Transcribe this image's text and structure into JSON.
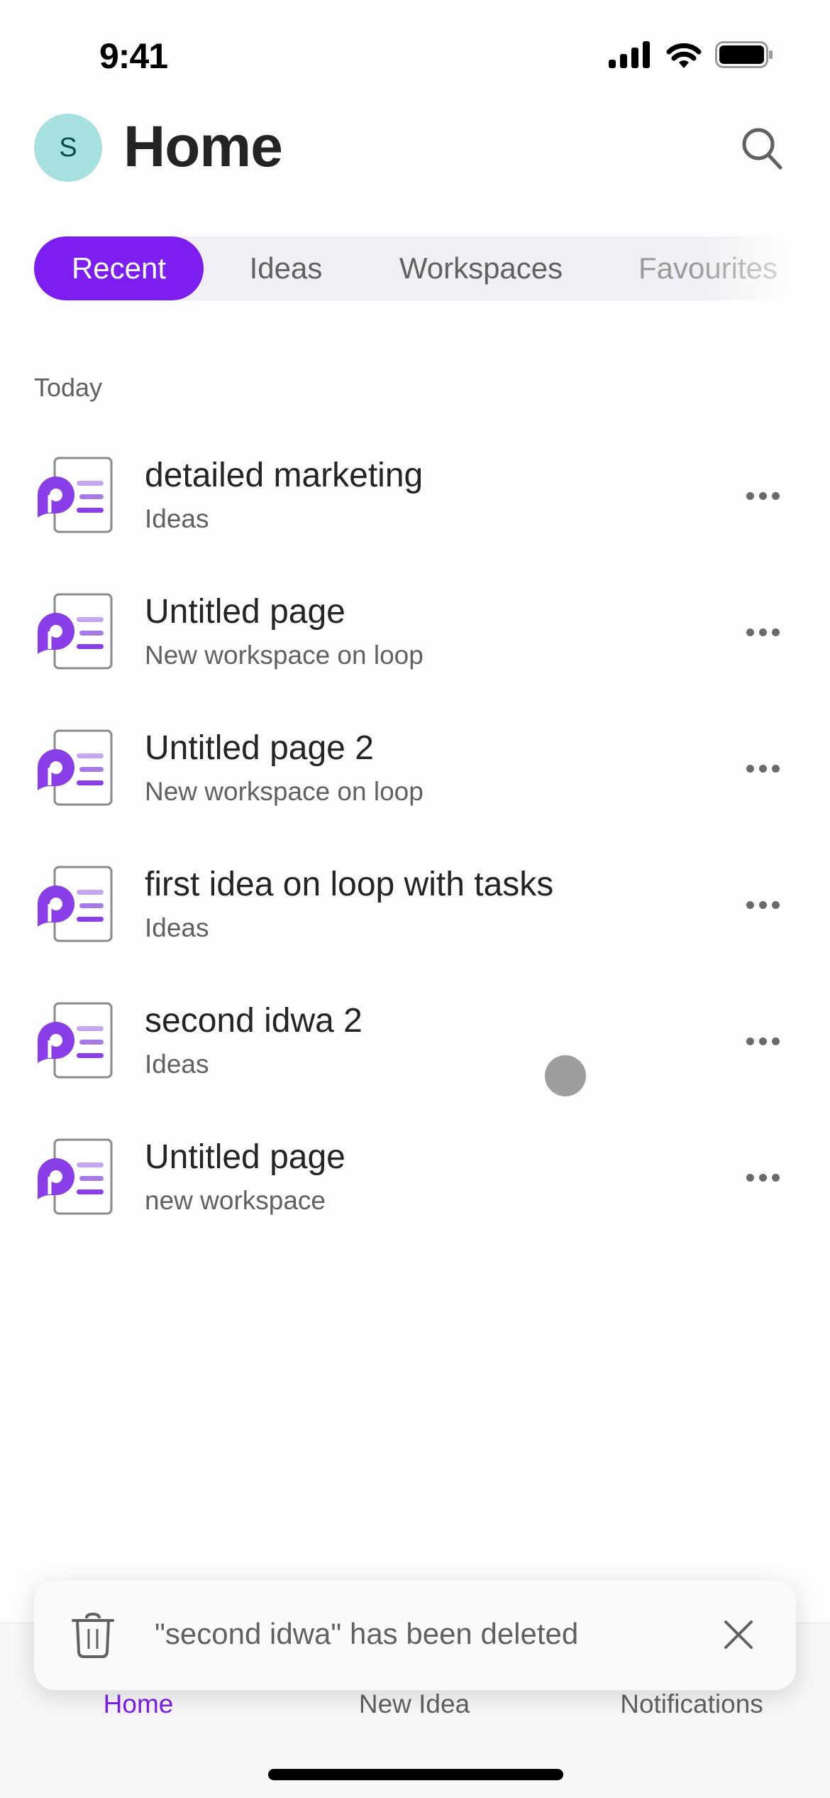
{
  "status_bar": {
    "time": "9:41"
  },
  "header": {
    "avatar_initial": "S",
    "title": "Home"
  },
  "tabs": [
    {
      "label": "Recent",
      "active": true
    },
    {
      "label": "Ideas",
      "active": false
    },
    {
      "label": "Workspaces",
      "active": false
    },
    {
      "label": "Favourites",
      "active": false
    }
  ],
  "section_label": "Today",
  "items": [
    {
      "title": "detailed marketing",
      "subtitle": "Ideas"
    },
    {
      "title": "Untitled page",
      "subtitle": "New workspace on loop"
    },
    {
      "title": "Untitled page 2",
      "subtitle": "New workspace on loop"
    },
    {
      "title": "first idea on loop with tasks",
      "subtitle": "Ideas"
    },
    {
      "title": "second idwa 2",
      "subtitle": "Ideas"
    },
    {
      "title": "Untitled page",
      "subtitle": "new workspace"
    }
  ],
  "toast": {
    "message": "\"second idwa\" has been deleted",
    "icon": "trash-icon"
  },
  "tab_bar": [
    {
      "label": "Home",
      "active": true
    },
    {
      "label": "New Idea",
      "active": false
    },
    {
      "label": "Notifications",
      "active": false
    }
  ],
  "colors": {
    "accent": "#7c1ef0",
    "avatar_bg": "#a6e1df",
    "avatar_text": "#0b4a4a"
  }
}
